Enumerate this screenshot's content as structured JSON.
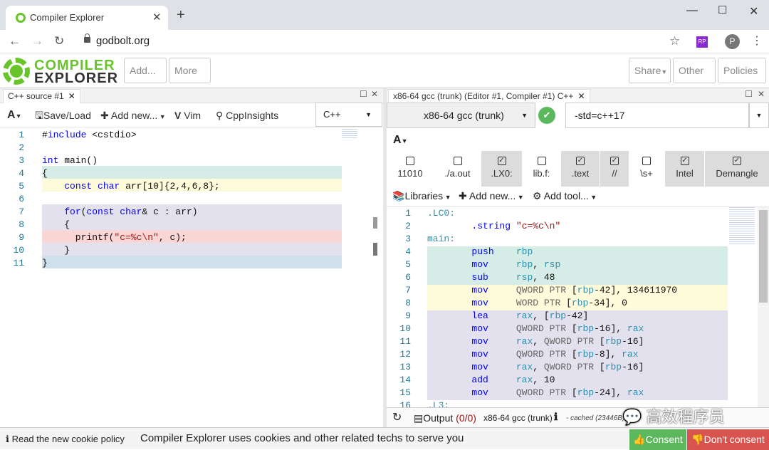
{
  "browser": {
    "tab_title": "Compiler Explorer",
    "url": "godbolt.org",
    "avatar_letter": "P",
    "ext_label": "RP"
  },
  "header": {
    "logo_line1": "COMPILER",
    "logo_line2": "EXPLORER",
    "add_label": "Add...",
    "more_label": "More",
    "share_label": "Share",
    "other_label": "Other",
    "policies_label": "Policies"
  },
  "editor": {
    "tab_label": "C++ source #1",
    "font_label": "A",
    "save_label": "Save/Load",
    "addnew_label": "Add new...",
    "vim_label": "Vim",
    "cppinsights_label": "CppInsights",
    "language": "C++",
    "line_numbers": [
      "1",
      "2",
      "3",
      "4",
      "5",
      "6",
      "7",
      "8",
      "9",
      "10",
      "11"
    ],
    "lines": [
      "#include <cstdio>",
      "",
      "int main()",
      "{",
      "    const char arr[10]{2,4,6,8};",
      "",
      "    for(const char& c : arr)",
      "    {",
      "      printf(\"c=%c\\n\", c);",
      "    }",
      "}"
    ]
  },
  "compiler": {
    "tab_label": "x86-64 gcc (trunk) (Editor #1, Compiler #1) C++",
    "compiler_name": "x86-64 gcc (trunk)",
    "options": "-std=c++17",
    "font_label": "A",
    "filters": [
      {
        "label": "11010",
        "checked": false
      },
      {
        "label": "./a.out",
        "checked": false
      },
      {
        "label": ".LX0:",
        "checked": true
      },
      {
        "label": "lib.f:",
        "checked": false
      },
      {
        "label": ".text",
        "checked": true
      },
      {
        "label": "//",
        "checked": true
      },
      {
        "label": "\\s+",
        "checked": false
      },
      {
        "label": "Intel",
        "checked": true
      },
      {
        "label": "Demangle",
        "checked": true
      }
    ],
    "libraries_label": "Libraries",
    "addnew_label": "Add new...",
    "addtool_label": "Add tool...",
    "line_numbers": [
      "1",
      "2",
      "3",
      "4",
      "5",
      "6",
      "7",
      "8",
      "9",
      "10",
      "11",
      "12",
      "13",
      "14",
      "15",
      "16"
    ],
    "asm": [
      ".LC0:",
      "        .string \"c=%c\\n\"",
      "main:",
      "        push    rbp",
      "        mov     rbp, rsp",
      "        sub     rsp, 48",
      "        mov     QWORD PTR [rbp-42], 134611970",
      "        mov     WORD PTR [rbp-34], 0",
      "        lea     rax, [rbp-42]",
      "        mov     QWORD PTR [rbp-16], rax",
      "        mov     rax, QWORD PTR [rbp-16]",
      "        mov     QWORD PTR [rbp-8], rax",
      "        mov     rax, QWORD PTR [rbp-16]",
      "        add     rax, 10",
      "        mov     QWORD PTR [rbp-24], rax",
      ".L3:"
    ],
    "output_label": "Output",
    "output_count": "(0/0)",
    "status_compiler": "x86-64 gcc (trunk)",
    "cached_label": "- cached (23446B)"
  },
  "cookie": {
    "link_label": "Read the new cookie policy",
    "message": "Compiler Explorer uses cookies and other related techs to serve you",
    "consent_label": "Consent",
    "dont_consent_label": "Don't consent"
  },
  "watermark": "💬 高效程序员",
  "colors": {
    "accent": "#67c52a",
    "band_green": "#d5ede6",
    "band_yellow": "#fdfbd9",
    "band_purple": "#e3e1ee",
    "band_red": "#f9d6d3",
    "band_blue": "#cfe0ec"
  }
}
